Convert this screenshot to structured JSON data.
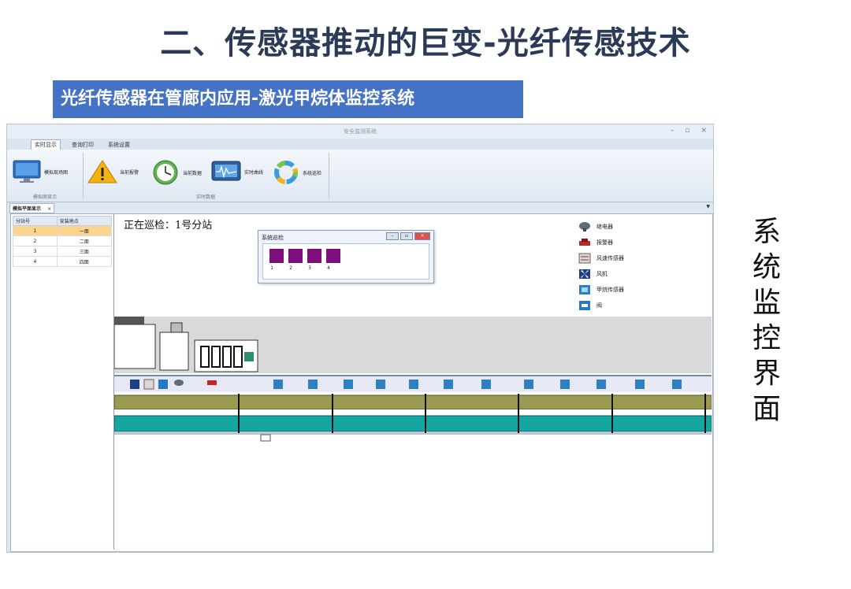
{
  "slide": {
    "title": "二、传感器推动的巨变-光纤传感技术",
    "subtitle": "光纤传感器在管廊内应用-激光甲烷体监控系统",
    "side_label": "系统监控界面"
  },
  "app": {
    "window_title": "安全监测系统",
    "window_controls": [
      "–",
      "▫",
      "×"
    ],
    "menu_tabs": [
      "实时显示",
      "查询打印",
      "系统设置"
    ],
    "ribbon": {
      "group1_label": "模拟图显示",
      "group2_label": "实时数据",
      "buttons": [
        "模拟现场图",
        "当前报警",
        "当前数据",
        "实时曲线",
        "系统巡检"
      ]
    },
    "doc_tab": "模拟平面显示",
    "doc_tab_close": "×",
    "station_table": {
      "headers": [
        "分站号",
        "安装地点"
      ],
      "rows": [
        [
          "1",
          "一面"
        ],
        [
          "2",
          "二面"
        ],
        [
          "3",
          "三面"
        ],
        [
          "4",
          "四面"
        ]
      ]
    },
    "patrol_status": "正在巡检：1号分站",
    "dialog": {
      "title": "系统巡检",
      "controls": [
        "–",
        "▫",
        "×"
      ],
      "stations": [
        "1",
        "2",
        "3",
        "4"
      ]
    },
    "legend": [
      {
        "icon": "relay-icon",
        "label": "继电器"
      },
      {
        "icon": "alarm-icon",
        "label": "报警器"
      },
      {
        "icon": "wind-speed-sensor-icon",
        "label": "风速传感器"
      },
      {
        "icon": "fan-icon",
        "label": "风机"
      },
      {
        "icon": "methane-sensor-icon",
        "label": "甲烷传感器"
      },
      {
        "icon": "valve-icon",
        "label": "阀"
      }
    ],
    "colors": {
      "station": "#7d0f7d",
      "pipe_yellow": "#9c9a52",
      "pipe_teal": "#14a6a0",
      "ribbon_blue": "#4472c4"
    }
  }
}
